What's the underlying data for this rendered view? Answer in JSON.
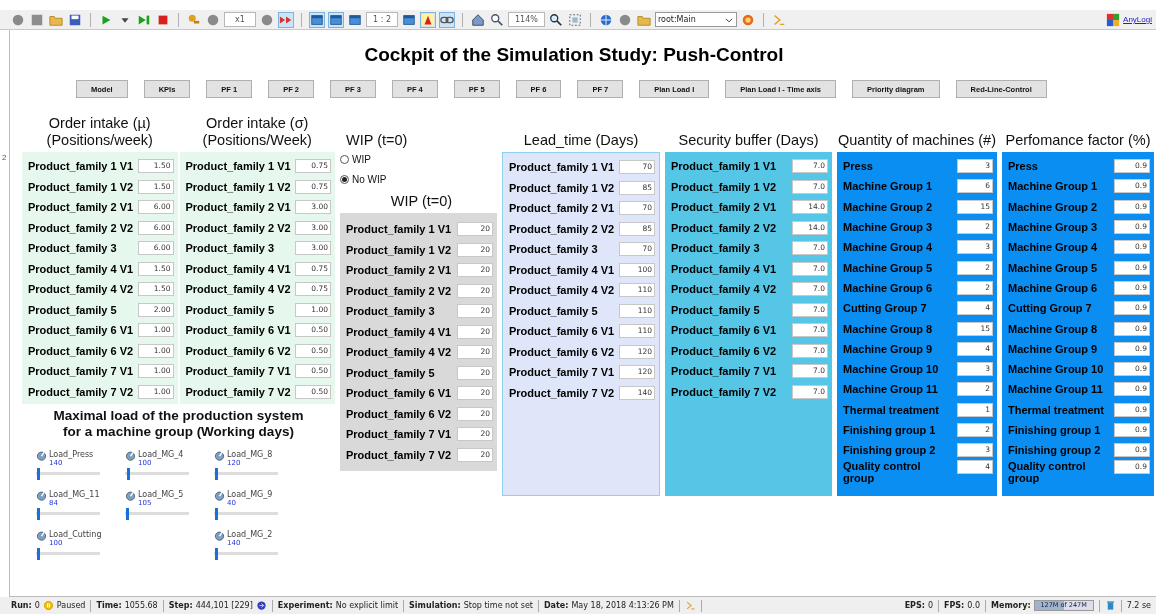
{
  "toolbar": {
    "tools": [
      {
        "kind": "disk",
        "selected": false
      },
      {
        "kind": "square",
        "selected": false
      },
      {
        "kind": "folder",
        "selected": false
      },
      {
        "kind": "save",
        "selected": false
      },
      {
        "kind": "sep"
      },
      {
        "kind": "play",
        "selected": false
      },
      {
        "kind": "caret",
        "selected": false
      },
      {
        "kind": "step",
        "selected": false
      },
      {
        "kind": "stop",
        "selected": false
      },
      {
        "kind": "sep"
      },
      {
        "kind": "key",
        "selected": false
      },
      {
        "kind": "disk",
        "selected": false
      },
      {
        "kind": "field",
        "text": "x1"
      },
      {
        "kind": "disk",
        "selected": false
      },
      {
        "kind": "fast",
        "selected": true
      },
      {
        "kind": "sep"
      },
      {
        "kind": "window",
        "selected": true
      },
      {
        "kind": "window",
        "selected": true
      },
      {
        "kind": "window",
        "selected": false
      },
      {
        "kind": "field",
        "text": "1 : 2"
      },
      {
        "kind": "window",
        "selected": false
      },
      {
        "kind": "highlight",
        "selected": true
      },
      {
        "kind": "link",
        "selected": true
      },
      {
        "kind": "sep"
      },
      {
        "kind": "home",
        "selected": false
      },
      {
        "kind": "zoom-out",
        "selected": false
      },
      {
        "kind": "field",
        "text": "114%"
      },
      {
        "kind": "zoom-in",
        "selected": false
      },
      {
        "kind": "fit",
        "selected": false
      },
      {
        "kind": "sep"
      },
      {
        "kind": "globe",
        "selected": false
      },
      {
        "kind": "disk",
        "selected": false
      },
      {
        "kind": "folder",
        "selected": false
      },
      {
        "kind": "dropdown",
        "text": "root:Main"
      },
      {
        "kind": "target",
        "selected": false
      },
      {
        "kind": "sep"
      },
      {
        "kind": "console",
        "selected": false
      }
    ],
    "brand": "AnyLogi"
  },
  "canvas_marker": "2",
  "title": "Cockpit of the Simulation Study: Push-Control",
  "nav_buttons": [
    "Model",
    "KPIs",
    "PF 1",
    "PF 2",
    "PF 3",
    "PF 4",
    "PF 5",
    "PF 6",
    "PF 7",
    "Plan Load I",
    "Plan Load I - Time axis",
    "Priority diagram",
    "Red-Line-Control"
  ],
  "order_intake_mean": {
    "heading": [
      "Order intake (µ)",
      "(Positions/week)"
    ],
    "rows": [
      {
        "label": "Product_family 1 V1",
        "value": "1.50"
      },
      {
        "label": "Product_family 1 V2",
        "value": "1.50"
      },
      {
        "label": "Product_family 2 V1",
        "value": "6.00"
      },
      {
        "label": "Product_family 2 V2",
        "value": "6.00"
      },
      {
        "label": "Product_family 3",
        "value": "6.00"
      },
      {
        "label": "Product_family 4 V1",
        "value": "1.50"
      },
      {
        "label": "Product_family 4 V2",
        "value": "1.50"
      },
      {
        "label": "Product_family 5",
        "value": "2.00"
      },
      {
        "label": "Product_family 6 V1",
        "value": "1.00"
      },
      {
        "label": "Product_family 6 V2",
        "value": "1.00"
      },
      {
        "label": "Product_family 7 V1",
        "value": "1.00"
      },
      {
        "label": "Product_family 7 V2",
        "value": "1.00"
      }
    ]
  },
  "order_intake_sd": {
    "heading": [
      "Order intake (σ)",
      "(Positions/Week)"
    ],
    "rows": [
      {
        "label": "Product_family 1 V1",
        "value": "0.75"
      },
      {
        "label": "Product_family 1 V2",
        "value": "0.75"
      },
      {
        "label": "Product_family 2 V1",
        "value": "3.00"
      },
      {
        "label": "Product_family 2 V2",
        "value": "3.00"
      },
      {
        "label": "Product_family 3",
        "value": "3.00"
      },
      {
        "label": "Product_family 4 V1",
        "value": "0.75"
      },
      {
        "label": "Product_family 4 V2",
        "value": "0.75"
      },
      {
        "label": "Product_family 5",
        "value": "1.00"
      },
      {
        "label": "Product_family 6 V1",
        "value": "0.50"
      },
      {
        "label": "Product_family 6 V2",
        "value": "0.50"
      },
      {
        "label": "Product_family 7 V1",
        "value": "0.50"
      },
      {
        "label": "Product_family 7 V2",
        "value": "0.50"
      }
    ]
  },
  "max_load": {
    "heading": [
      "Maximal load of the production system",
      "for a machine group (Working days)"
    ],
    "columns": [
      [
        {
          "label": "Load_Press",
          "value": "140",
          "level": 0.02
        },
        {
          "label": "Load_MG_11",
          "value": "84",
          "level": 0.02
        },
        {
          "label": "Load_Cutting",
          "value": "100",
          "level": 0.02
        }
      ],
      [
        {
          "label": "Load_MG_4",
          "value": "100",
          "level": 0.03
        },
        {
          "label": "Load_MG_5",
          "value": "105",
          "level": 0.02
        }
      ],
      [
        {
          "label": "Load_MG_8",
          "value": "120",
          "level": 0.02
        },
        {
          "label": "Load_MG_9",
          "value": "40",
          "level": 0.02
        },
        {
          "label": "Load_MG_2",
          "value": "140",
          "level": 0.02
        }
      ]
    ]
  },
  "wip_choice": {
    "heading": "WIP (t=0)",
    "options": [
      {
        "label": "WIP",
        "selected": false
      },
      {
        "label": "No WIP",
        "selected": true
      }
    ]
  },
  "wip": {
    "heading": "WIP (t=0)",
    "rows": [
      {
        "label": "Product_family 1 V1",
        "value": "20"
      },
      {
        "label": "Product_family 1 V2",
        "value": "20"
      },
      {
        "label": "Product_family 2 V1",
        "value": "20"
      },
      {
        "label": "Product_family 2 V2",
        "value": "20"
      },
      {
        "label": "Product_family 3",
        "value": "20"
      },
      {
        "label": "Product_family 4 V1",
        "value": "20"
      },
      {
        "label": "Product_family 4 V2",
        "value": "20"
      },
      {
        "label": "Product_family 5",
        "value": "20"
      },
      {
        "label": "Product_family 6 V1",
        "value": "20"
      },
      {
        "label": "Product_family 6 V2",
        "value": "20"
      },
      {
        "label": "Product_family 7 V1",
        "value": "20"
      },
      {
        "label": "Product_family 7 V2",
        "value": "20"
      }
    ]
  },
  "lead_time": {
    "heading": "Lead_time (Days)",
    "rows": [
      {
        "label": "Product_family 1 V1",
        "value": "70"
      },
      {
        "label": "Product_family 1 V2",
        "value": "85"
      },
      {
        "label": "Product_family 2 V1",
        "value": "70"
      },
      {
        "label": "Product_family 2 V2",
        "value": "85"
      },
      {
        "label": "Product_family 3",
        "value": "70"
      },
      {
        "label": "Product_family 4 V1",
        "value": "100"
      },
      {
        "label": "Product_family 4 V2",
        "value": "110"
      },
      {
        "label": "Product_family 5",
        "value": "110"
      },
      {
        "label": "Product_family 6 V1",
        "value": "110"
      },
      {
        "label": "Product_family 6 V2",
        "value": "120"
      },
      {
        "label": "Product_family 7 V1",
        "value": "120"
      },
      {
        "label": "Product_family 7 V2",
        "value": "140"
      }
    ]
  },
  "security_buffer": {
    "heading": "Security buffer (Days)",
    "rows": [
      {
        "label": "Product_family 1 V1",
        "value": "7.0"
      },
      {
        "label": "Product_family 1 V2",
        "value": "7.0"
      },
      {
        "label": "Product_family 2 V1",
        "value": "14.0"
      },
      {
        "label": "Product_family 2 V2",
        "value": "14.0"
      },
      {
        "label": "Product_family 3",
        "value": "7.0"
      },
      {
        "label": "Product_family 4 V1",
        "value": "7.0"
      },
      {
        "label": "Product_family 4 V2",
        "value": "7.0"
      },
      {
        "label": "Product_family 5",
        "value": "7.0"
      },
      {
        "label": "Product_family 6 V1",
        "value": "7.0"
      },
      {
        "label": "Product_family 6 V2",
        "value": "7.0"
      },
      {
        "label": "Product_family 7 V1",
        "value": "7.0"
      },
      {
        "label": "Product_family 7 V2",
        "value": "7.0"
      }
    ]
  },
  "machine_quantity": {
    "heading": "Quantity of machines (#)",
    "rows": [
      {
        "label": "Press",
        "value": "3"
      },
      {
        "label": "Machine Group 1",
        "value": "6"
      },
      {
        "label": "Machine Group 2",
        "value": "15"
      },
      {
        "label": "Machine Group 3",
        "value": "2"
      },
      {
        "label": "Machine Group 4",
        "value": "3"
      },
      {
        "label": "Machine Group 5",
        "value": "2"
      },
      {
        "label": "Machine Group 6",
        "value": "2"
      },
      {
        "label": "Cutting Group 7",
        "value": "4"
      },
      {
        "label": "Machine Group 8",
        "value": "15"
      },
      {
        "label": "Machine Group 9",
        "value": "4"
      },
      {
        "label": "Machine Group 10",
        "value": "3"
      },
      {
        "label": "Machine Group 11",
        "value": "2"
      },
      {
        "label": "Thermal treatment",
        "value": "1"
      },
      {
        "label": "Finishing group 1",
        "value": "2"
      },
      {
        "label": "Finishing group 2",
        "value": "3"
      },
      {
        "label": "Quality control group",
        "value": "4"
      }
    ]
  },
  "performance_factor": {
    "heading": "Perfomance factor (%)",
    "rows": [
      {
        "label": "Press",
        "value": "0.9"
      },
      {
        "label": "Machine Group 1",
        "value": "0.9"
      },
      {
        "label": "Machine Group 2",
        "value": "0.9"
      },
      {
        "label": "Machine Group 3",
        "value": "0.9"
      },
      {
        "label": "Machine Group 4",
        "value": "0.9"
      },
      {
        "label": "Machine Group 5",
        "value": "0.9"
      },
      {
        "label": "Machine Group 6",
        "value": "0.9"
      },
      {
        "label": "Cutting Group 7",
        "value": "0.9"
      },
      {
        "label": "Machine Group 8",
        "value": "0.9"
      },
      {
        "label": "Machine Group 9",
        "value": "0.9"
      },
      {
        "label": "Machine Group 10",
        "value": "0.9"
      },
      {
        "label": "Machine Group 11",
        "value": "0.9"
      },
      {
        "label": "Thermal treatment",
        "value": "0.9"
      },
      {
        "label": "Finishing group 1",
        "value": "0.9"
      },
      {
        "label": "Finishing group 2",
        "value": "0.9"
      },
      {
        "label": "Quality control group",
        "value": "0.9"
      }
    ]
  },
  "status_bar": {
    "left": [
      {
        "kind": "run",
        "label": "Run:",
        "value": "0",
        "state": "Paused"
      },
      {
        "kind": "text",
        "label": "Time:",
        "value": "1055.68"
      },
      {
        "kind": "step",
        "label": "Step:",
        "value": "444,101 [229]"
      },
      {
        "kind": "text",
        "label": "Experiment:",
        "value": "No explicit limit"
      },
      {
        "kind": "text",
        "label": "Simulation:",
        "value": "Stop time not set"
      },
      {
        "kind": "text",
        "label": "Date:",
        "value": "May 18, 2018 4:13:26 PM"
      }
    ],
    "right": [
      {
        "kind": "text",
        "label": "EPS:",
        "value": "0"
      },
      {
        "kind": "text",
        "label": "FPS:",
        "value": "0.0"
      },
      {
        "kind": "memory",
        "label": "Memory:",
        "value": "127M of 247M",
        "level": 0.51
      }
    ],
    "elapsed": "7.2 se"
  }
}
